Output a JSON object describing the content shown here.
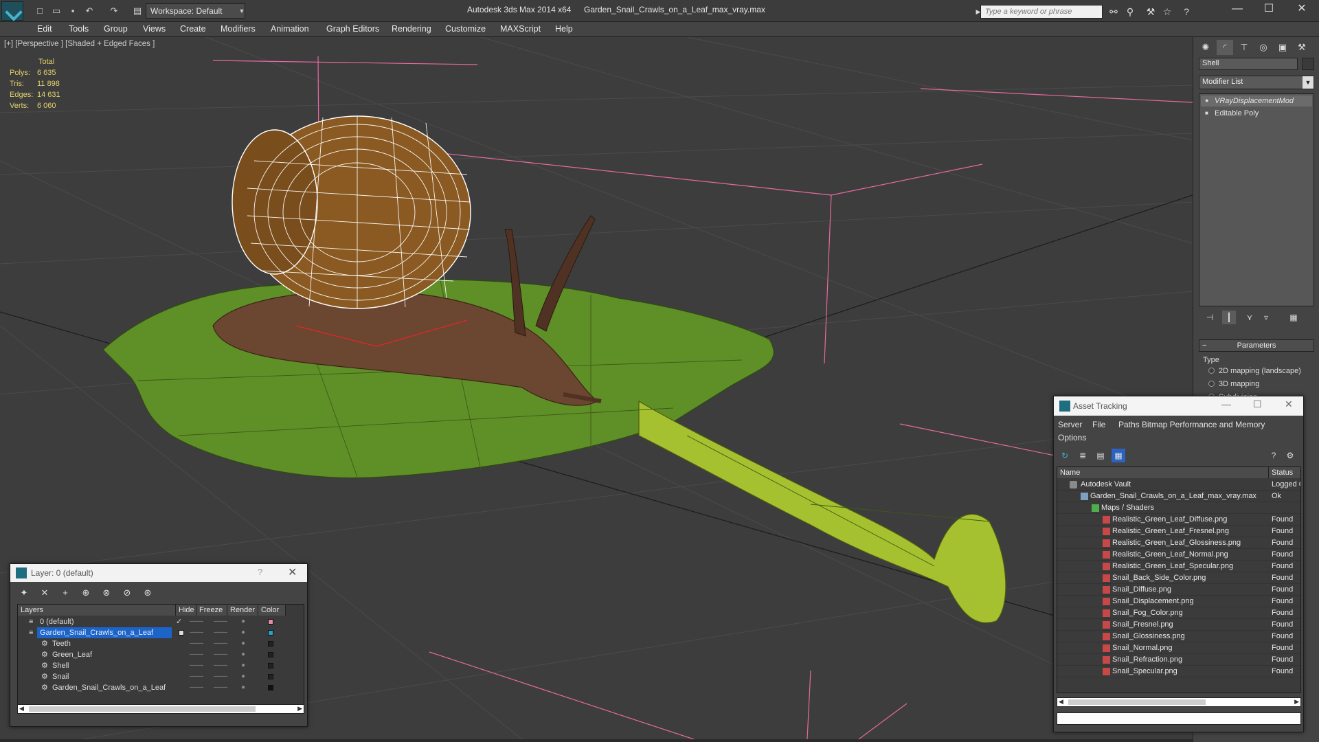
{
  "titlebar": {
    "workspace": "Workspace: Default",
    "app_title": "Autodesk 3ds Max  2014 x64",
    "file_title": "Garden_Snail_Crawls_on_a_Leaf_max_vray.max",
    "search_placeholder": "Type a keyword or phrase"
  },
  "menu": [
    "Edit",
    "Tools",
    "Group",
    "Views",
    "Create",
    "Modifiers",
    "Animation",
    "Graph Editors",
    "Rendering",
    "Customize",
    "MAXScript",
    "Help"
  ],
  "viewport": {
    "label": "[+] [Perspective ] [Shaded + Edged Faces ]",
    "stats_header": "Total",
    "stats": [
      {
        "k": "Polys:",
        "v": "6 635"
      },
      {
        "k": "Tris:",
        "v": "11 898"
      },
      {
        "k": "Edges:",
        "v": "14 631"
      },
      {
        "k": "Verts:",
        "v": "6 060"
      }
    ]
  },
  "command_panel": {
    "object_name": "Shell",
    "modifier_list": "Modifier List",
    "stack": [
      "VRayDisplacementMod",
      "Editable Poly"
    ],
    "params_title": "Parameters",
    "type_label": "Type",
    "radios": [
      "2D mapping (landscape)",
      "3D mapping",
      "Subdivision"
    ]
  },
  "layer_window": {
    "title": "Layer: 0 (default)",
    "help": "?",
    "headers": [
      "Layers",
      "Hide",
      "Freeze",
      "Render",
      "Color"
    ],
    "rows": [
      {
        "name": "0 (default)",
        "indent": 0,
        "color": "#e08ab0",
        "checked": true,
        "selected": false
      },
      {
        "name": "Garden_Snail_Crawls_on_a_Leaf",
        "indent": 0,
        "color": "#2aa0c8",
        "checked": false,
        "selected": true
      },
      {
        "name": "Teeth",
        "indent": 1,
        "color": "#222222",
        "checked": false,
        "selected": false
      },
      {
        "name": "Green_Leaf",
        "indent": 1,
        "color": "#222222",
        "checked": false,
        "selected": false
      },
      {
        "name": "Shell",
        "indent": 1,
        "color": "#222222",
        "checked": false,
        "selected": false
      },
      {
        "name": "Snail",
        "indent": 1,
        "color": "#222222",
        "checked": false,
        "selected": false
      },
      {
        "name": "Garden_Snail_Crawls_on_a_Leaf",
        "indent": 1,
        "color": "#111111",
        "checked": false,
        "selected": false
      }
    ]
  },
  "asset_window": {
    "title": "Asset Tracking",
    "menu": [
      "Server",
      "File",
      "Paths",
      "Bitmap Performance and Memory",
      "Options"
    ],
    "headers": [
      "Name",
      "Status"
    ],
    "rows": [
      {
        "name": "Autodesk Vault",
        "status": "Logged Out",
        "level": 0,
        "icon": "vault"
      },
      {
        "name": "Garden_Snail_Crawls_on_a_Leaf_max_vray.max",
        "status": "Ok",
        "level": 1,
        "icon": "file"
      },
      {
        "name": "Maps / Shaders",
        "status": "",
        "level": 2,
        "icon": "maps"
      },
      {
        "name": "Realistic_Green_Leaf_Diffuse.png",
        "status": "Found",
        "level": 3,
        "icon": "png"
      },
      {
        "name": "Realistic_Green_Leaf_Fresnel.png",
        "status": "Found",
        "level": 3,
        "icon": "png"
      },
      {
        "name": "Realistic_Green_Leaf_Glossiness.png",
        "status": "Found",
        "level": 3,
        "icon": "png"
      },
      {
        "name": "Realistic_Green_Leaf_Normal.png",
        "status": "Found",
        "level": 3,
        "icon": "png"
      },
      {
        "name": "Realistic_Green_Leaf_Specular.png",
        "status": "Found",
        "level": 3,
        "icon": "png"
      },
      {
        "name": "Snail_Back_Side_Color.png",
        "status": "Found",
        "level": 3,
        "icon": "png"
      },
      {
        "name": "Snail_Diffuse.png",
        "status": "Found",
        "level": 3,
        "icon": "png"
      },
      {
        "name": "Snail_Displacement.png",
        "status": "Found",
        "level": 3,
        "icon": "png"
      },
      {
        "name": "Snail_Fog_Color.png",
        "status": "Found",
        "level": 3,
        "icon": "png"
      },
      {
        "name": "Snail_Fresnel.png",
        "status": "Found",
        "level": 3,
        "icon": "png"
      },
      {
        "name": "Snail_Glossiness.png",
        "status": "Found",
        "level": 3,
        "icon": "png"
      },
      {
        "name": "Snail_Normal.png",
        "status": "Found",
        "level": 3,
        "icon": "png"
      },
      {
        "name": "Snail_Refraction.png",
        "status": "Found",
        "level": 3,
        "icon": "png"
      },
      {
        "name": "Snail_Specular.png",
        "status": "Found",
        "level": 3,
        "icon": "png"
      }
    ]
  },
  "colors": {
    "stats_text": "#e3d26b",
    "selection": "#1c64c8",
    "grid": "#4c4c4c",
    "pink_lines": "#e86aa0",
    "leaf": "#6a9a2a",
    "stem": "#a9c430",
    "shell": "#8a5a22",
    "body": "#6b4630"
  }
}
